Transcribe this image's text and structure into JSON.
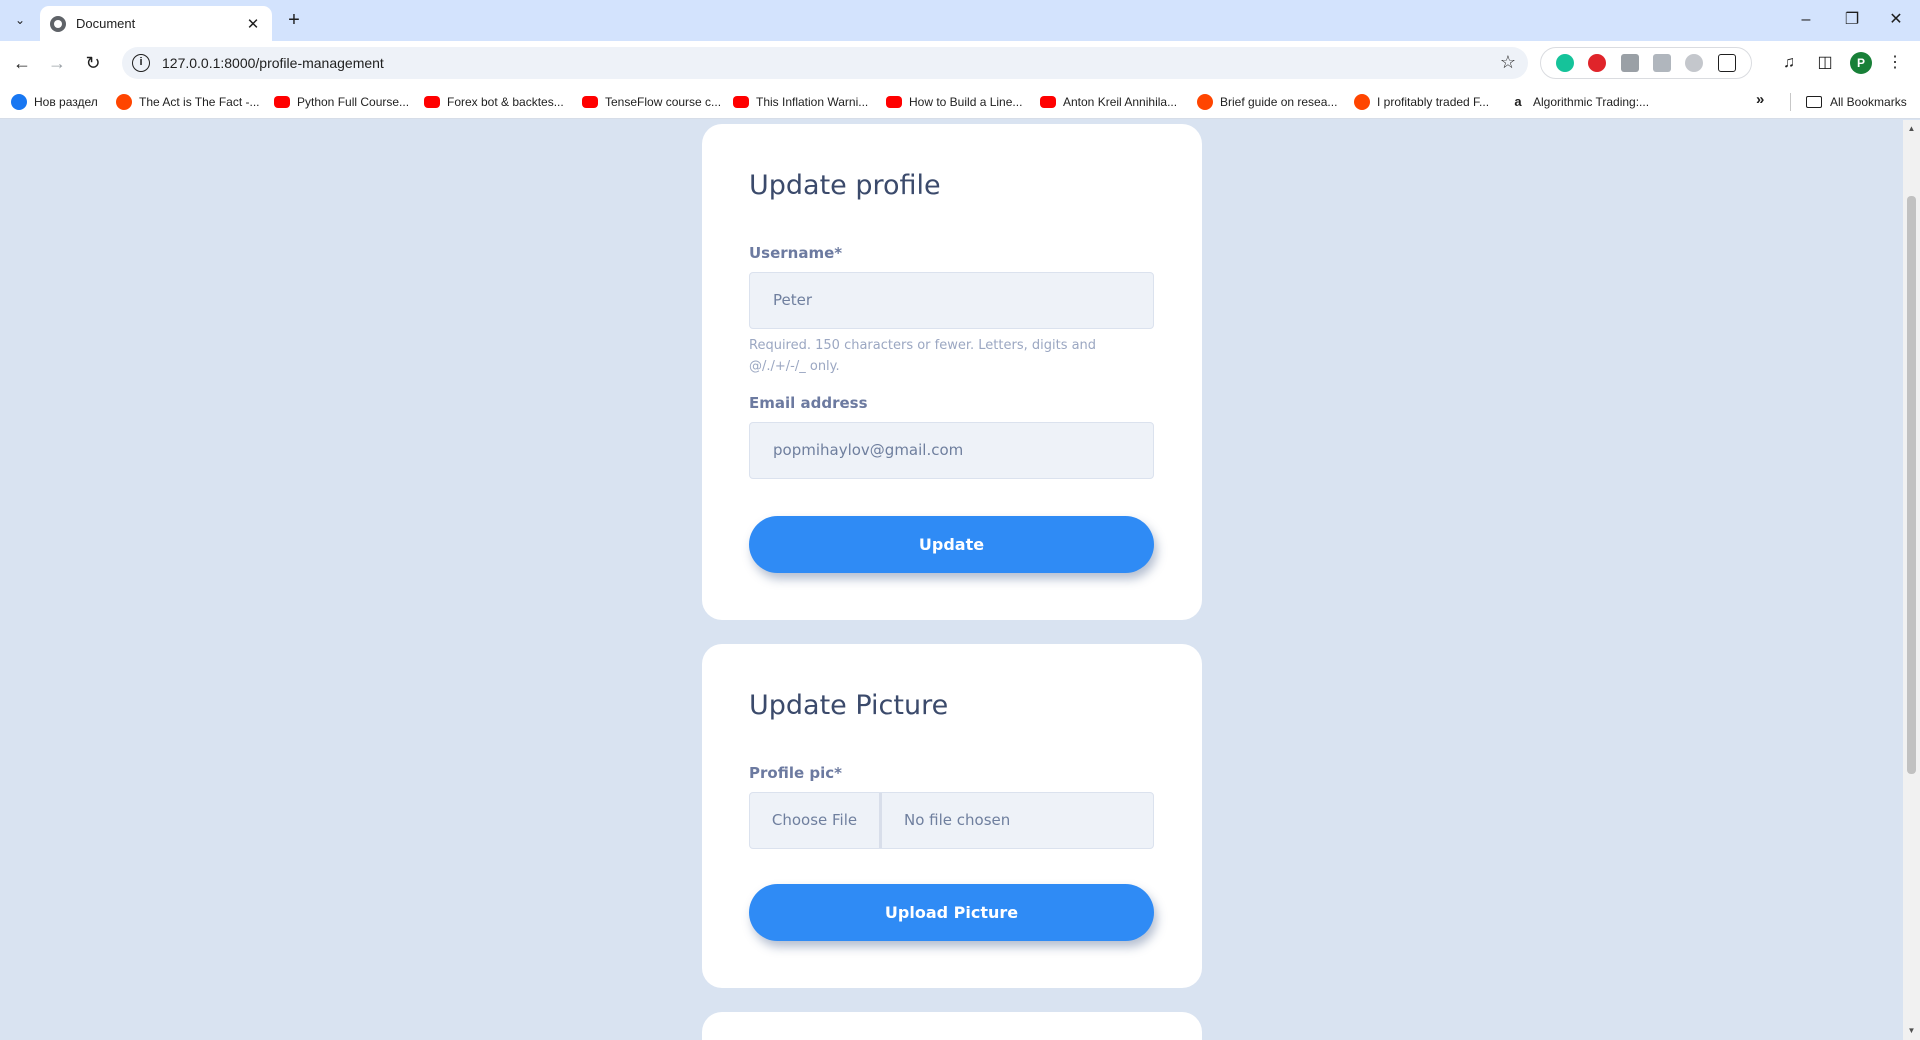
{
  "browser": {
    "tab_title": "Document",
    "tab_close": "✕",
    "new_tab": "+",
    "url": "127.0.0.1:8000/profile-management",
    "profile_initial": "P"
  },
  "bookmarks": [
    {
      "label": "Нов раздел",
      "icon": "facebook-icon"
    },
    {
      "label": "The Act is The Fact -...",
      "icon": "reddit-icon"
    },
    {
      "label": "Python Full Course...",
      "icon": "youtube-icon"
    },
    {
      "label": "Forex bot & backtes...",
      "icon": "youtube-icon"
    },
    {
      "label": "TenseFlow course c...",
      "icon": "youtube-icon"
    },
    {
      "label": "This Inflation Warni...",
      "icon": "youtube-icon"
    },
    {
      "label": "How to Build a Line...",
      "icon": "youtube-icon"
    },
    {
      "label": "Anton Kreil Annihila...",
      "icon": "youtube-icon"
    },
    {
      "label": "Brief guide on resea...",
      "icon": "reddit-icon"
    },
    {
      "label": "I profitably traded F...",
      "icon": "reddit-icon"
    },
    {
      "label": "Algorithmic Trading:...",
      "icon": "amazon-icon"
    }
  ],
  "all_bookmarks_label": "All Bookmarks",
  "profile_form": {
    "title": "Update profile",
    "username_label": "Username*",
    "username_value": "Peter",
    "username_help": "Required. 150 characters or fewer. Letters, digits and @/./+/-/_ only.",
    "email_label": "Email address",
    "email_value": "popmihaylov@gmail.com",
    "submit_label": "Update"
  },
  "picture_form": {
    "title": "Update Picture",
    "pic_label": "Profile pic*",
    "choose_file_label": "Choose File",
    "no_file_label": "No file chosen",
    "submit_label": "Upload Picture"
  },
  "colors": {
    "background": "#d9e3f1",
    "primary_button": "#2f8bf5",
    "card": "#ffffff",
    "title_text": "#3b4a6b"
  }
}
